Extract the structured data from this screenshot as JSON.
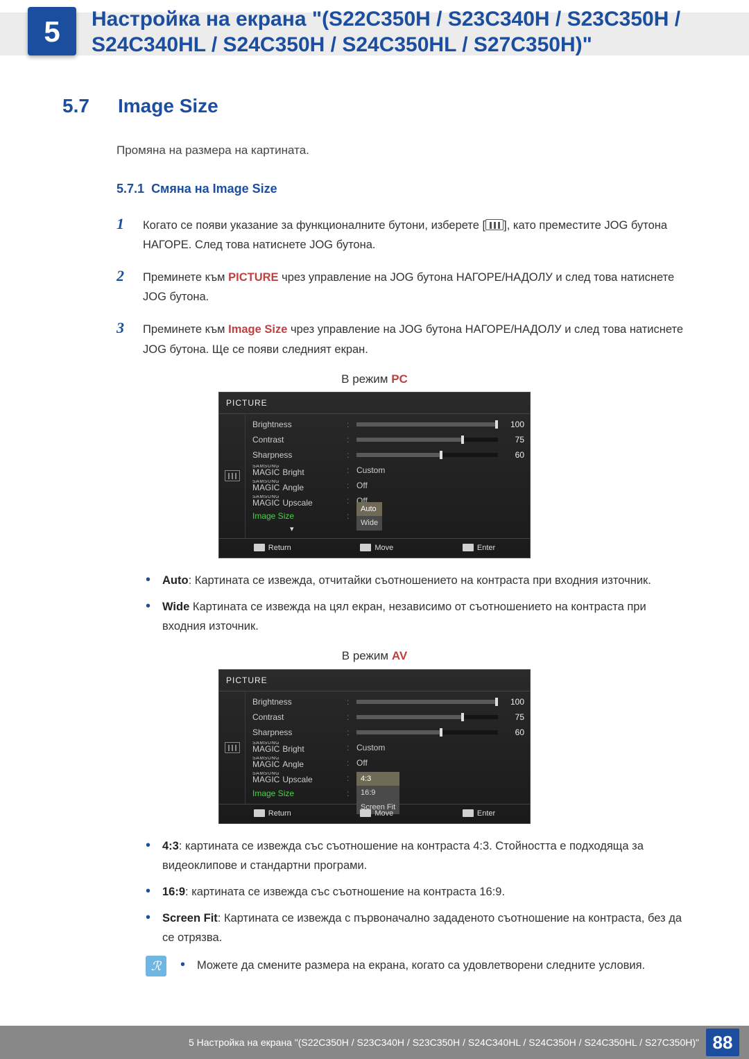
{
  "chapter_number": "5",
  "chapter_title": "Настройка на екрана \"(S22C350H / S23C340H / S23C350H / S24C340HL / S24C350H / S24C350HL / S27C350H)\"",
  "section": {
    "number": "5.7",
    "title": "Image Size",
    "intro": "Промяна на размера на картината."
  },
  "subsection": {
    "number": "5.7.1",
    "title": "Смяна на Image Size"
  },
  "steps": [
    {
      "num": "1",
      "pre": "Когато се появи указание за функционалните бутони, изберете [",
      "post": "], като преместите JOG бутона НАГОРЕ. След това натиснете JOG бутона."
    },
    {
      "num": "2",
      "pre": "Преминете към ",
      "kw": "PICTURE",
      "post": " чрез управление на JOG бутона НАГОРЕ/НАДОЛУ и след това натиснете JOG бутона."
    },
    {
      "num": "3",
      "pre": "Преминете към ",
      "kw": "Image Size",
      "post": " чрез управление на JOG бутона НАГОРЕ/НАДОЛУ и след това натиснете JOG бутона. Ще се появи следният екран."
    }
  ],
  "mode_pc": {
    "prefix": "В режим ",
    "mode": "PC"
  },
  "mode_av": {
    "prefix": "В режим ",
    "mode": "AV"
  },
  "osd": {
    "title": "PICTURE",
    "rows": {
      "brightness": {
        "label": "Brightness",
        "value": "100",
        "pct": 100
      },
      "contrast": {
        "label": "Contrast",
        "value": "75",
        "pct": 75
      },
      "sharpness": {
        "label": "Sharpness",
        "value": "60",
        "pct": 60
      },
      "magic_bright": {
        "prefix": "SAMSUNG",
        "brand": "MAGIC",
        "suffix": "Bright",
        "value": "Custom"
      },
      "magic_angle": {
        "prefix": "SAMSUNG",
        "brand": "MAGIC",
        "suffix": "Angle",
        "value": "Off"
      },
      "magic_upscale": {
        "prefix": "SAMSUNG",
        "brand": "MAGIC",
        "suffix": "Upscale",
        "value": "Off"
      },
      "image_size": {
        "label": "Image Size"
      }
    },
    "options_pc": [
      "Auto",
      "Wide"
    ],
    "options_av": [
      "4:3",
      "16:9",
      "Screen Fit"
    ],
    "footer": {
      "return": "Return",
      "move": "Move",
      "enter": "Enter"
    }
  },
  "bullets_pc": [
    {
      "kw": "Auto",
      "text": ": Картината се извежда, отчитайки съотношението на контраста при входния източник."
    },
    {
      "kw": "Wide",
      "text": " Картината се извежда на цял екран, независимо от съотношението на контраста при входния източник."
    }
  ],
  "bullets_av": [
    {
      "kw": "4:3",
      "text": ": картината се извежда със съотношение на контраста 4:3. Стойността е подходяща за видеоклипове и стандартни програми."
    },
    {
      "kw": "16:9",
      "text": ": картината се извежда със съотношение на контраста 16:9."
    },
    {
      "kw": "Screen Fit",
      "text": ": Картината се извежда с първоначално зададеното съотношение на контраста, без да се отрязва."
    }
  ],
  "info_note": "Можете да смените размера на екрана, когато са удовлетворени следните условия.",
  "footer": {
    "text": "5 Настройка на екрана \"(S22C350H / S23C340H / S23C350H / S24C340HL / S24C350H / S24C350HL / S27C350H)\"",
    "page": "88"
  }
}
